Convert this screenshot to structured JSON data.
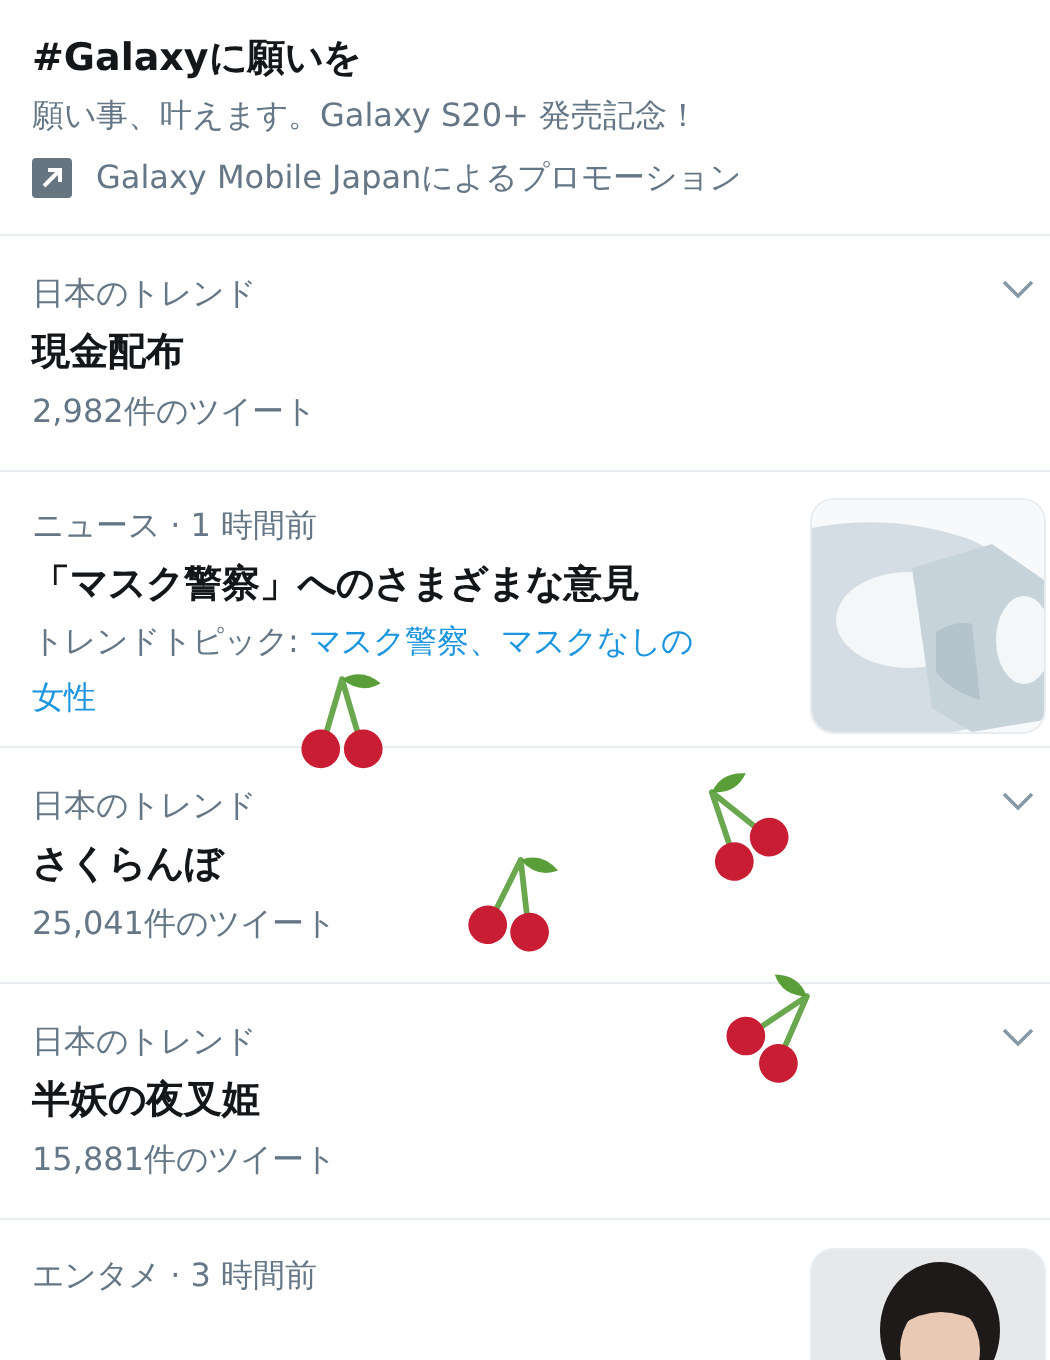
{
  "promoted": {
    "title": "#Galaxyに願いを",
    "description": "願い事、叶えます。Galaxy S20+ 発売記念！",
    "promoter": "Galaxy Mobile Japanによるプロモーション"
  },
  "trends": [
    {
      "kind": "trend",
      "category": "日本のトレンド",
      "title": "現金配布",
      "count": "2,982件のツイート"
    },
    {
      "kind": "news",
      "meta": "ニュース · 1 時間前",
      "title": "「マスク警察」へのさまざまな意見",
      "topics_label": "トレンドトピック: ",
      "topics": "マスク警察、マスクなしの女性"
    },
    {
      "kind": "trend",
      "category": "日本のトレンド",
      "title": "さくらんぼ",
      "count": "25,041件のツイート"
    },
    {
      "kind": "trend",
      "category": "日本のトレンド",
      "title": "半妖の夜叉姫",
      "count": "15,881件のツイート"
    },
    {
      "kind": "news",
      "meta": "エンタメ · 3 時間前"
    }
  ]
}
